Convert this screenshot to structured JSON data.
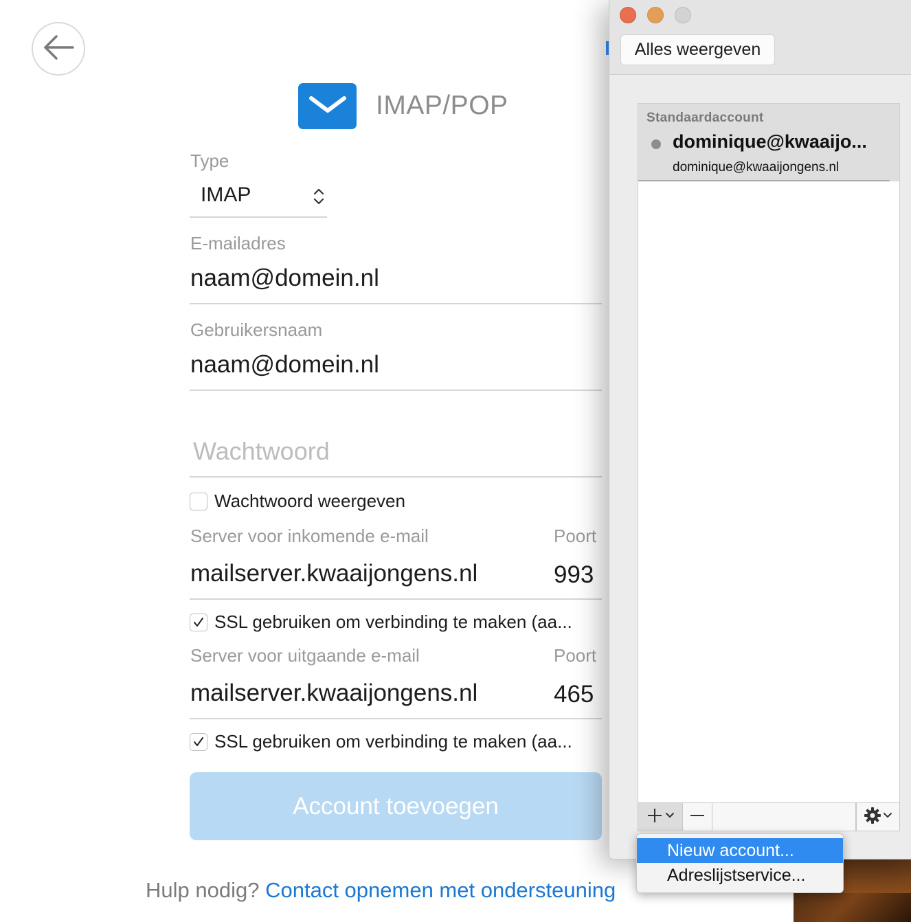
{
  "header": {
    "title": "IMAP/POP"
  },
  "form": {
    "type_label": "Type",
    "type_value": "IMAP",
    "email_label": "E-mailadres",
    "email_value": "naam@domein.nl",
    "username_label": "Gebruikersnaam",
    "username_value": "naam@domein.nl",
    "password_placeholder": "Wachtwoord",
    "show_password_label": "Wachtwoord weergeven",
    "show_password_checked": false,
    "incoming_label": "Server voor inkomende e-mail",
    "incoming_port_label": "Poort",
    "incoming_server": "mailserver.kwaaijongens.nl",
    "incoming_port": "993",
    "incoming_ssl_label": "SSL gebruiken om verbinding te maken (aa...",
    "incoming_ssl_checked": true,
    "outgoing_label": "Server voor uitgaande e-mail",
    "outgoing_port_label": "Poort",
    "outgoing_server": "mailserver.kwaaijongens.nl",
    "outgoing_port": "465",
    "outgoing_ssl_label": "SSL gebruiken om verbinding te maken (aa...",
    "outgoing_ssl_checked": true,
    "submit_label": "Account toevoegen"
  },
  "help": {
    "prefix": "Hulp nodig?",
    "link": "Contact opnemen met ondersteuning"
  },
  "accounts_window": {
    "show_all_label": "Alles weergeven",
    "group_label": "Standaardaccount",
    "account_name": "dominique@kwaaijo...",
    "account_email": "dominique@kwaaijongens.nl",
    "menu": [
      {
        "label": "Nieuw account...",
        "highlighted": true
      },
      {
        "label": "Adreslijstservice...",
        "highlighted": false
      }
    ]
  },
  "colors": {
    "accent": "#1a83d9",
    "link": "#1a78d3",
    "button_disabled": "#b8d9f4",
    "menu_highlight": "#2f8bf0"
  }
}
